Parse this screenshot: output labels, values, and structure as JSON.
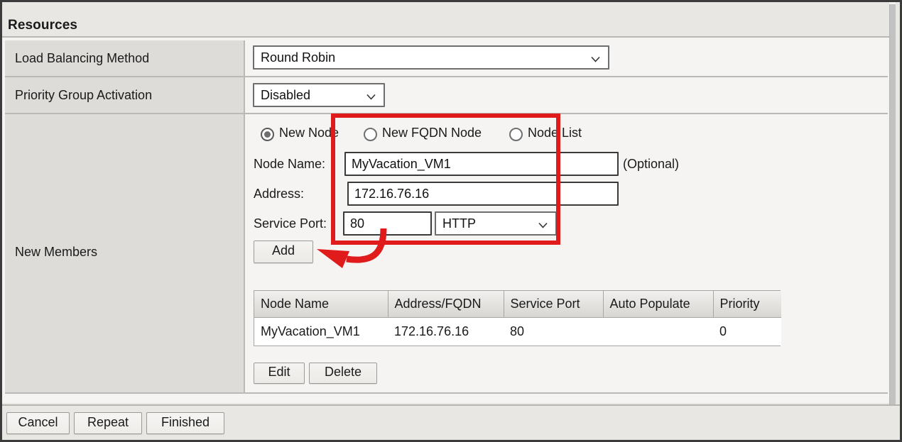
{
  "section": {
    "title": "Resources"
  },
  "rows": {
    "load_balancing": {
      "label": "Load Balancing Method",
      "value": "Round Robin"
    },
    "priority_group": {
      "label": "Priority Group Activation",
      "value": "Disabled"
    },
    "new_members": {
      "label": "New Members"
    }
  },
  "new_members": {
    "radios": [
      {
        "label": "New Node",
        "selected": true
      },
      {
        "label": "New FQDN Node",
        "selected": false
      },
      {
        "label": "Node List",
        "selected": false
      }
    ],
    "fields": {
      "node_name_label": "Node Name:",
      "node_name_value": "MyVacation_VM1",
      "optional_note": "(Optional)",
      "address_label": "Address:",
      "address_value": "172.16.76.16",
      "service_port_label": "Service Port:",
      "service_port_value": "80",
      "protocol_value": "HTTP"
    },
    "add_button": "Add",
    "table": {
      "columns": [
        "Node Name",
        "Address/FQDN",
        "Service Port",
        "Auto Populate",
        "Priority"
      ],
      "rows": [
        {
          "node_name": "MyVacation_VM1",
          "address": "172.16.76.16",
          "service_port": "80",
          "auto_populate": "",
          "priority": "0"
        }
      ]
    },
    "edit_button": "Edit",
    "delete_button": "Delete"
  },
  "actionbar": {
    "cancel": "Cancel",
    "repeat": "Repeat",
    "finished": "Finished"
  },
  "annotation": {
    "highlight_color": "#e01b1b",
    "points_to": "Add"
  }
}
